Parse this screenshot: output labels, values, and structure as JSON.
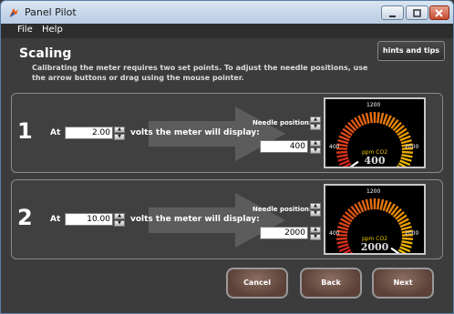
{
  "window": {
    "title": "Panel Pilot"
  },
  "menu": {
    "file": "File",
    "help": "Help"
  },
  "header": {
    "title": "Scaling",
    "description": "Calibrating the meter requires two set points. To adjust the needle positions, use the arrow buttons or drag using the mouse pointer.",
    "hints_button": "hints and tips"
  },
  "steps": [
    {
      "number": "1",
      "at_label": "At",
      "volts_value": "2.00",
      "display_label": "volts the meter will display:",
      "needle_label": "Needle position:",
      "needle_value": "400",
      "meter": {
        "min_label": "400",
        "mid_label": "1200",
        "max_label": "2000",
        "unit": "ppm CO2",
        "reading": "400",
        "needle_fraction": 0.0
      }
    },
    {
      "number": "2",
      "at_label": "At",
      "volts_value": "10.00",
      "display_label": "volts the meter will display:",
      "needle_label": "Needle position:",
      "needle_value": "2000",
      "meter": {
        "min_label": "400",
        "mid_label": "1200",
        "max_label": "2000",
        "unit": "ppm CO2",
        "reading": "2000",
        "needle_fraction": 1.0
      }
    }
  ],
  "footer": {
    "cancel": "Cancel",
    "back": "Back",
    "next": "Next"
  },
  "colors": {
    "accent_red": "#d42020",
    "accent_yellow": "#f0c000",
    "button_brown": "#6b4f44"
  }
}
